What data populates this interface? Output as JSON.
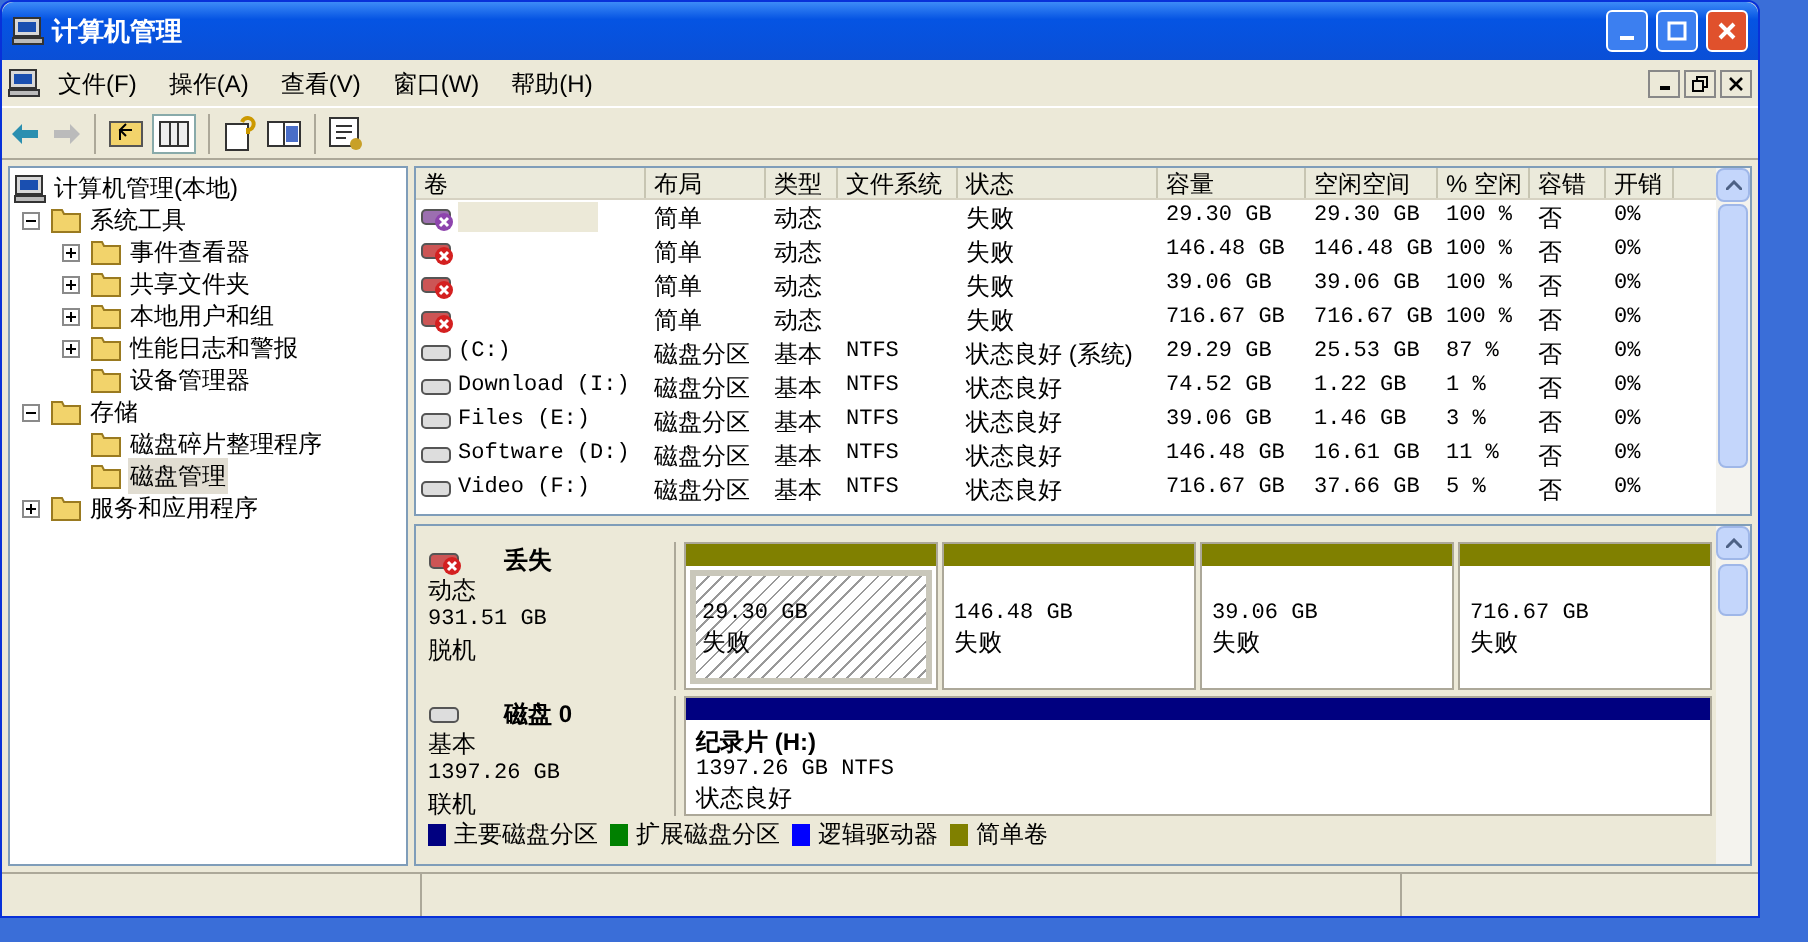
{
  "window": {
    "title": "计算机管理"
  },
  "menu": [
    "文件(F)",
    "操作(A)",
    "查看(V)",
    "窗口(W)",
    "帮助(H)"
  ],
  "tree": [
    {
      "label": "计算机管理(本地)",
      "kind": "root",
      "selected": false,
      "children": [
        {
          "label": "系统工具",
          "kind": "expanded",
          "selected": false,
          "children": [
            {
              "label": "事件查看器",
              "kind": "collapsed",
              "selected": false
            },
            {
              "label": "共享文件夹",
              "kind": "collapsed",
              "selected": false
            },
            {
              "label": "本地用户和组",
              "kind": "collapsed",
              "selected": false
            },
            {
              "label": "性能日志和警报",
              "kind": "collapsed",
              "selected": false
            },
            {
              "label": "设备管理器",
              "kind": "leaf",
              "selected": false
            }
          ]
        },
        {
          "label": "存储",
          "kind": "expanded",
          "selected": false,
          "children": [
            {
              "label": "磁盘碎片整理程序",
              "kind": "leaf",
              "selected": false
            },
            {
              "label": "磁盘管理",
              "kind": "leaf",
              "selected": true
            }
          ]
        },
        {
          "label": "服务和应用程序",
          "kind": "collapsed",
          "selected": false
        }
      ]
    }
  ],
  "volumes": {
    "columns": [
      "卷",
      "布局",
      "类型",
      "文件系统",
      "状态",
      "容量",
      "空闲空间",
      "% 空闲",
      "容错",
      "开销"
    ],
    "rows": [
      {
        "kind": "failed",
        "selected": true,
        "layout": "简单",
        "type": "动态",
        "status": "失败",
        "capacity": "29.30 GB",
        "free": "29.30 GB",
        "pct_free": "100 %",
        "fault_tolerance": "否",
        "overhead": "0%"
      },
      {
        "kind": "failed",
        "selected": false,
        "layout": "简单",
        "type": "动态",
        "status": "失败",
        "capacity": "146.48 GB",
        "free": "146.48 GB",
        "pct_free": "100 %",
        "fault_tolerance": "否",
        "overhead": "0%"
      },
      {
        "kind": "failed",
        "selected": false,
        "layout": "简单",
        "type": "动态",
        "status": "失败",
        "capacity": "39.06 GB",
        "free": "39.06 GB",
        "pct_free": "100 %",
        "fault_tolerance": "否",
        "overhead": "0%"
      },
      {
        "kind": "failed",
        "selected": false,
        "layout": "简单",
        "type": "动态",
        "status": "失败",
        "capacity": "716.67 GB",
        "free": "716.67 GB",
        "pct_free": "100 %",
        "fault_tolerance": "否",
        "overhead": "0%"
      },
      {
        "kind": "basic",
        "selected": false,
        "volume": "(C:)",
        "layout": "磁盘分区",
        "type": "基本",
        "fs": "NTFS",
        "status": "状态良好 (系统)",
        "capacity": "29.29 GB",
        "free": "25.53 GB",
        "pct_free": "87 %",
        "fault_tolerance": "否",
        "overhead": "0%"
      },
      {
        "kind": "basic",
        "selected": false,
        "volume": "Download (I:)",
        "layout": "磁盘分区",
        "type": "基本",
        "fs": "NTFS",
        "status": "状态良好",
        "capacity": "74.52 GB",
        "free": "1.22 GB",
        "pct_free": "1 %",
        "fault_tolerance": "否",
        "overhead": "0%"
      },
      {
        "kind": "basic",
        "selected": false,
        "volume": "Files (E:)",
        "layout": "磁盘分区",
        "type": "基本",
        "fs": "NTFS",
        "status": "状态良好",
        "capacity": "39.06 GB",
        "free": "1.46 GB",
        "pct_free": "3 %",
        "fault_tolerance": "否",
        "overhead": "0%"
      },
      {
        "kind": "basic",
        "selected": false,
        "volume": "Software (D:)",
        "layout": "磁盘分区",
        "type": "基本",
        "fs": "NTFS",
        "status": "状态良好",
        "capacity": "146.48 GB",
        "free": "16.61 GB",
        "pct_free": "11 %",
        "fault_tolerance": "否",
        "overhead": "0%"
      },
      {
        "kind": "basic",
        "selected": false,
        "volume": "Video (F:)",
        "layout": "磁盘分区",
        "type": "基本",
        "fs": "NTFS",
        "status": "状态良好",
        "capacity": "716.67 GB",
        "free": "37.66 GB",
        "pct_free": "5 %",
        "fault_tolerance": "否",
        "overhead": "0%"
      }
    ]
  },
  "disks": [
    {
      "kind": "failed",
      "name": "丢失",
      "type": "动态",
      "size": "931.51 GB",
      "status": "脱机",
      "partitions": [
        {
          "size": "29.30 GB",
          "status": "失败",
          "color": "#808000",
          "selected": true
        },
        {
          "size": "146.48 GB",
          "status": "失败",
          "color": "#808000",
          "selected": false
        },
        {
          "size": "39.06 GB",
          "status": "失败",
          "color": "#808000",
          "selected": false
        },
        {
          "size": "716.67 GB",
          "status": "失败",
          "color": "#808000",
          "selected": false
        }
      ]
    },
    {
      "kind": "basic",
      "name": "磁盘 0",
      "type": "基本",
      "size": "1397.26 GB",
      "status": "联机",
      "partitions": [
        {
          "label": "纪录片 (H:)",
          "size": "1397.26 GB NTFS",
          "status": "状态良好",
          "color": "#000080",
          "selected": false
        }
      ]
    }
  ],
  "legend": [
    {
      "label": "主要磁盘分区",
      "color": "#000080"
    },
    {
      "label": "扩展磁盘分区",
      "color": "#008000"
    },
    {
      "label": "逻辑驱动器",
      "color": "#0000ff"
    },
    {
      "label": "简单卷",
      "color": "#808000"
    }
  ]
}
